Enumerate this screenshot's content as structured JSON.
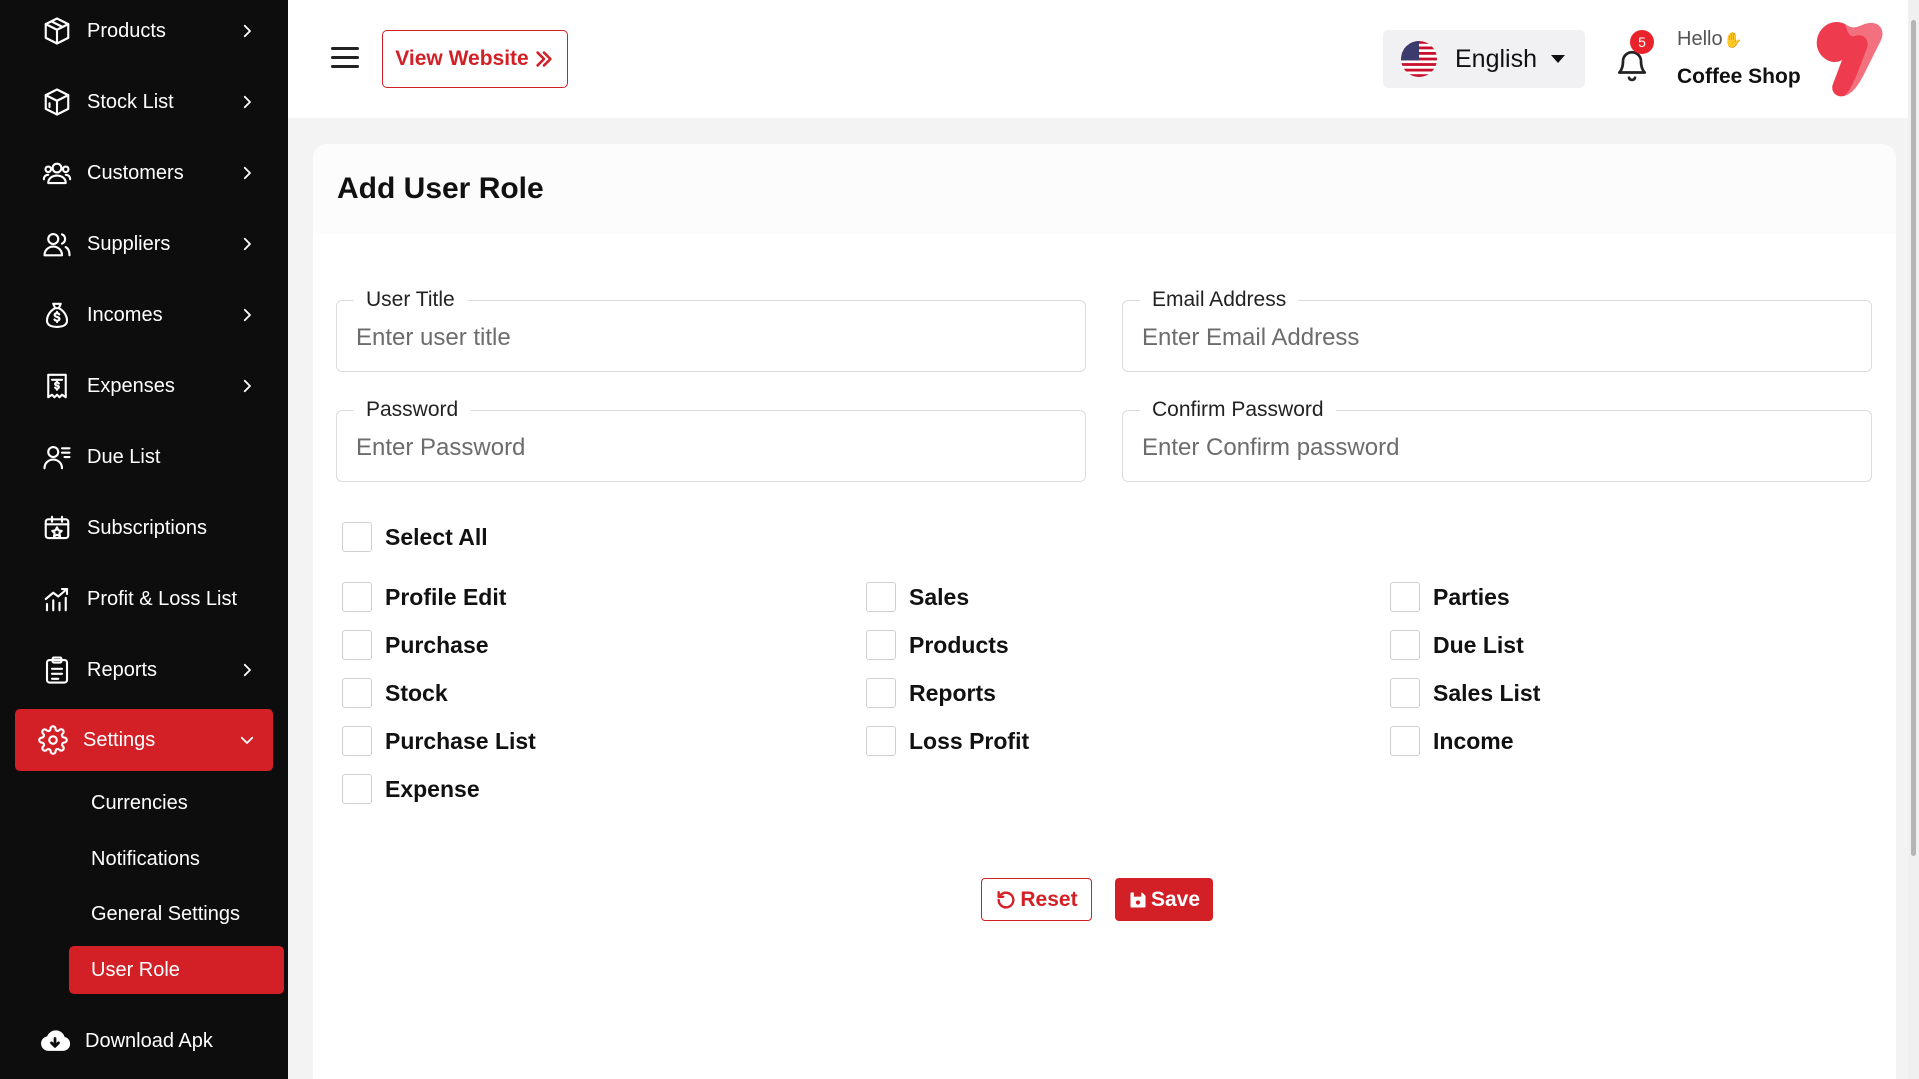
{
  "sidebar": {
    "items": [
      {
        "label": "Products",
        "icon": "box-icon"
      },
      {
        "label": "Stock List",
        "icon": "stock-box-icon"
      },
      {
        "label": "Customers",
        "icon": "users-icon"
      },
      {
        "label": "Suppliers",
        "icon": "supplier-icon"
      },
      {
        "label": "Incomes",
        "icon": "money-bag-icon"
      },
      {
        "label": "Expenses",
        "icon": "receipt-icon"
      },
      {
        "label": "Due List",
        "icon": "user-list-icon"
      },
      {
        "label": "Subscriptions",
        "icon": "subscription-icon"
      },
      {
        "label": "Profit & Loss List",
        "icon": "chart-icon"
      },
      {
        "label": "Reports",
        "icon": "report-icon"
      },
      {
        "label": "Settings",
        "icon": "gear-icon"
      }
    ],
    "settings_sub": [
      "Currencies",
      "Notifications",
      "General Settings",
      "User Role"
    ],
    "download": "Download Apk"
  },
  "header": {
    "view_website": "View Website",
    "language": "English",
    "notification_count": "5",
    "greeting": "Hello",
    "shop_name": "Coffee Shop"
  },
  "form": {
    "title": "Add User Role",
    "user_title": {
      "label": "User Title",
      "placeholder": "Enter user title"
    },
    "email": {
      "label": "Email Address",
      "placeholder": "Enter Email Address"
    },
    "password": {
      "label": "Password",
      "placeholder": "Enter Password"
    },
    "confirm_password": {
      "label": "Confirm Password",
      "placeholder": "Enter Confirm password"
    },
    "select_all": "Select All",
    "permissions": {
      "col1": [
        "Profile Edit",
        "Purchase",
        "Stock",
        "Purchase List",
        "Expense"
      ],
      "col2": [
        "Sales",
        "Products",
        "Reports",
        "Loss Profit"
      ],
      "col3": [
        "Parties",
        "Due List",
        "Sales List",
        "Income"
      ]
    },
    "reset": "Reset",
    "save": "Save"
  },
  "colors": {
    "accent": "#d32027",
    "sidebar_bg": "#0d0d0d",
    "page_bg": "#f3f3f4"
  }
}
